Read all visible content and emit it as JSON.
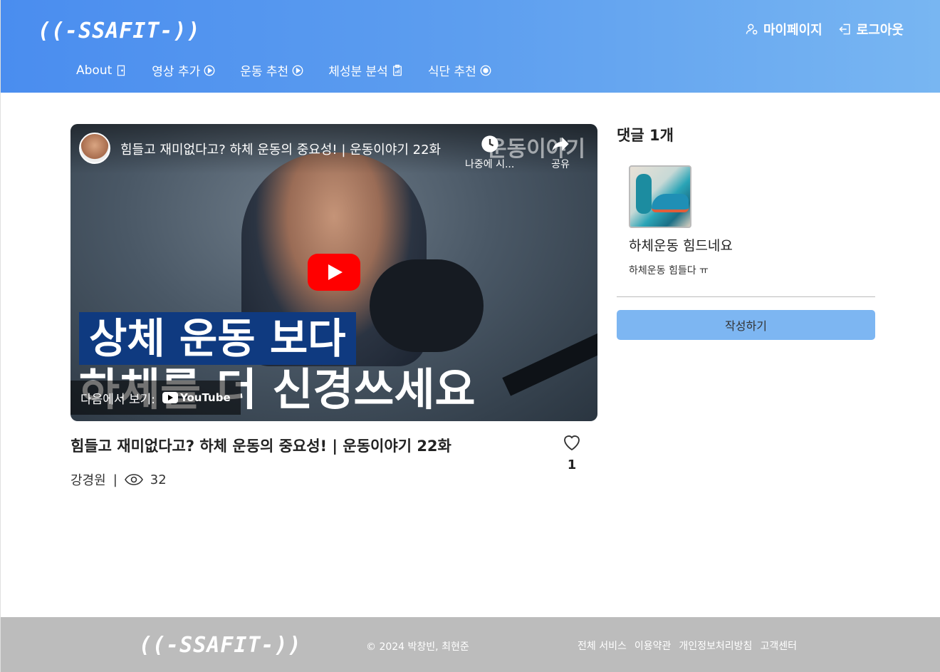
{
  "header": {
    "logo": "((-SSAFIT-))",
    "mypage_label": "마이페이지",
    "logout_label": "로그아웃",
    "nav": [
      {
        "label": "About",
        "icon": "door-icon"
      },
      {
        "label": "영상 추가",
        "icon": "play-circle-icon"
      },
      {
        "label": "운동 추천",
        "icon": "play-circle-icon"
      },
      {
        "label": "체성분 분석",
        "icon": "clipboard-chart-icon"
      },
      {
        "label": "식단 추천",
        "icon": "food-icon"
      }
    ]
  },
  "video": {
    "overlay_title": "힘들고 재미없다고? 하체 운동의 중요성! | 운동이야기 22화",
    "watermark": "운동이야기",
    "watch_later_label": "나중에 시...",
    "share_label": "공유",
    "caption_line1": "상체 운동 보다",
    "caption_line2": "하체를 더 신경쓰세요",
    "watch_on_label": "다음에서 보기:",
    "youtube_label": "YouTube",
    "title": "힘들고 재미없다고? 하체 운동의 중요성! | 운동이야기 22화",
    "author": "강경원",
    "separator": "|",
    "views": "32",
    "likes": "1"
  },
  "comments": {
    "header": "댓글 1개",
    "items": [
      {
        "title": "하체운동 힘드네요",
        "body": "하체운동 힘들다 ㅠ"
      }
    ],
    "write_label": "작성하기"
  },
  "footer": {
    "logo": "((-SSAFIT-))",
    "copyright": "© 2024 박창빈, 최현준",
    "links": [
      "전체 서비스",
      "이용약관",
      "개인정보처리방침",
      "고객센터"
    ]
  },
  "colors": {
    "header_start": "#4a8def",
    "header_end": "#78b6f2",
    "button": "#7db6f2",
    "footer": "#bcbcbc",
    "play_red": "#ff0000"
  }
}
